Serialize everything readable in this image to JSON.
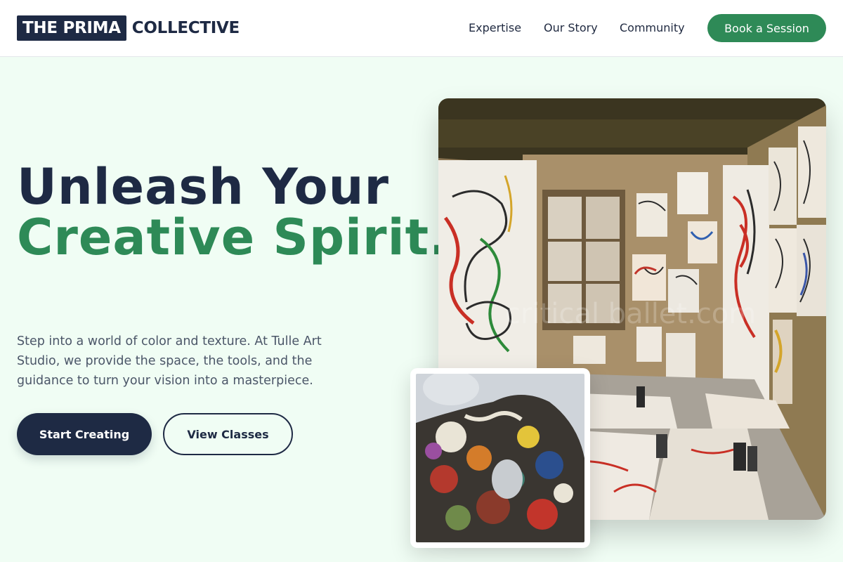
{
  "header": {
    "logo_box": "THE PRIMA",
    "logo_text": "COLLECTIVE",
    "nav": [
      "Expertise",
      "Our Story",
      "Community"
    ],
    "cta": "Book a Session"
  },
  "hero": {
    "title_line1": "Unleash Your",
    "title_line2": "Creative Spirit.",
    "description": "Step into a world of color and texture. At Tulle Art Studio, we provide the space, the tools, and the guidance to turn your vision into a masterpiece.",
    "primary_button": "Start Creating",
    "secondary_button": "View Classes"
  },
  "images": {
    "studio_watermark": "critical ballet.com"
  },
  "colors": {
    "navy": "#1e2a44",
    "green": "#2e8a57",
    "background": "#f0fdf4"
  }
}
